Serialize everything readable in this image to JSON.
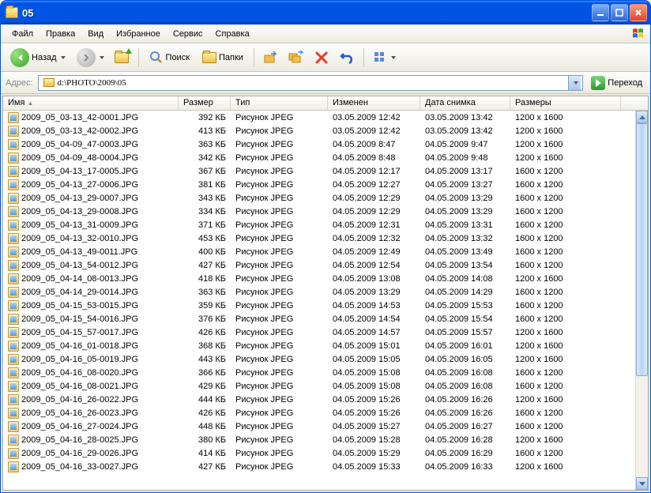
{
  "window": {
    "title": "05"
  },
  "menu": {
    "file": "Файл",
    "edit": "Правка",
    "view": "Вид",
    "favorites": "Избранное",
    "tools": "Сервис",
    "help": "Справка"
  },
  "toolbar": {
    "back": "Назад",
    "search": "Поиск",
    "folders": "Папки"
  },
  "addressbar": {
    "label": "Адрес:",
    "path": "d:\\PHOTO\\2009\\05",
    "go": "Переход"
  },
  "columns": {
    "name": "Имя",
    "size": "Размер",
    "type": "Тип",
    "modified": "Изменен",
    "shot": "Дата снимка",
    "dim": "Размеры"
  },
  "file_type": "Рисунок JPEG",
  "files": [
    {
      "name": "2009_05_03-13_42-0001.JPG",
      "size": "392 КБ",
      "mod": "03.05.2009 12:42",
      "shot": "03.05.2009 13:42",
      "dim": "1200 x 1600"
    },
    {
      "name": "2009_05_03-13_42-0002.JPG",
      "size": "413 КБ",
      "mod": "03.05.2009 12:42",
      "shot": "03.05.2009 13:42",
      "dim": "1200 x 1600"
    },
    {
      "name": "2009_05_04-09_47-0003.JPG",
      "size": "363 КБ",
      "mod": "04.05.2009 8:47",
      "shot": "04.05.2009 9:47",
      "dim": "1200 x 1600"
    },
    {
      "name": "2009_05_04-09_48-0004.JPG",
      "size": "342 КБ",
      "mod": "04.05.2009 8:48",
      "shot": "04.05.2009 9:48",
      "dim": "1200 x 1600"
    },
    {
      "name": "2009_05_04-13_17-0005.JPG",
      "size": "367 КБ",
      "mod": "04.05.2009 12:17",
      "shot": "04.05.2009 13:17",
      "dim": "1600 x 1200"
    },
    {
      "name": "2009_05_04-13_27-0006.JPG",
      "size": "381 КБ",
      "mod": "04.05.2009 12:27",
      "shot": "04.05.2009 13:27",
      "dim": "1600 x 1200"
    },
    {
      "name": "2009_05_04-13_29-0007.JPG",
      "size": "343 КБ",
      "mod": "04.05.2009 12:29",
      "shot": "04.05.2009 13:29",
      "dim": "1600 x 1200"
    },
    {
      "name": "2009_05_04-13_29-0008.JPG",
      "size": "334 КБ",
      "mod": "04.05.2009 12:29",
      "shot": "04.05.2009 13:29",
      "dim": "1600 x 1200"
    },
    {
      "name": "2009_05_04-13_31-0009.JPG",
      "size": "371 КБ",
      "mod": "04.05.2009 12:31",
      "shot": "04.05.2009 13:31",
      "dim": "1600 x 1200"
    },
    {
      "name": "2009_05_04-13_32-0010.JPG",
      "size": "453 КБ",
      "mod": "04.05.2009 12:32",
      "shot": "04.05.2009 13:32",
      "dim": "1600 x 1200"
    },
    {
      "name": "2009_05_04-13_49-0011.JPG",
      "size": "400 КБ",
      "mod": "04.05.2009 12:49",
      "shot": "04.05.2009 13:49",
      "dim": "1600 x 1200"
    },
    {
      "name": "2009_05_04-13_54-0012.JPG",
      "size": "427 КБ",
      "mod": "04.05.2009 12:54",
      "shot": "04.05.2009 13:54",
      "dim": "1600 x 1200"
    },
    {
      "name": "2009_05_04-14_08-0013.JPG",
      "size": "418 КБ",
      "mod": "04.05.2009 13:08",
      "shot": "04.05.2009 14:08",
      "dim": "1200 x 1600"
    },
    {
      "name": "2009_05_04-14_29-0014.JPG",
      "size": "363 КБ",
      "mod": "04.05.2009 13:29",
      "shot": "04.05.2009 14:29",
      "dim": "1600 x 1200"
    },
    {
      "name": "2009_05_04-15_53-0015.JPG",
      "size": "359 КБ",
      "mod": "04.05.2009 14:53",
      "shot": "04.05.2009 15:53",
      "dim": "1600 x 1200"
    },
    {
      "name": "2009_05_04-15_54-0016.JPG",
      "size": "376 КБ",
      "mod": "04.05.2009 14:54",
      "shot": "04.05.2009 15:54",
      "dim": "1600 x 1200"
    },
    {
      "name": "2009_05_04-15_57-0017.JPG",
      "size": "426 КБ",
      "mod": "04.05.2009 14:57",
      "shot": "04.05.2009 15:57",
      "dim": "1200 x 1600"
    },
    {
      "name": "2009_05_04-16_01-0018.JPG",
      "size": "368 КБ",
      "mod": "04.05.2009 15:01",
      "shot": "04.05.2009 16:01",
      "dim": "1200 x 1600"
    },
    {
      "name": "2009_05_04-16_05-0019.JPG",
      "size": "443 КБ",
      "mod": "04.05.2009 15:05",
      "shot": "04.05.2009 16:05",
      "dim": "1200 x 1600"
    },
    {
      "name": "2009_05_04-16_08-0020.JPG",
      "size": "366 КБ",
      "mod": "04.05.2009 15:08",
      "shot": "04.05.2009 16:08",
      "dim": "1600 x 1200"
    },
    {
      "name": "2009_05_04-16_08-0021.JPG",
      "size": "429 КБ",
      "mod": "04.05.2009 15:08",
      "shot": "04.05.2009 16:08",
      "dim": "1600 x 1200"
    },
    {
      "name": "2009_05_04-16_26-0022.JPG",
      "size": "444 КБ",
      "mod": "04.05.2009 15:26",
      "shot": "04.05.2009 16:26",
      "dim": "1200 x 1600"
    },
    {
      "name": "2009_05_04-16_26-0023.JPG",
      "size": "426 КБ",
      "mod": "04.05.2009 15:26",
      "shot": "04.05.2009 16:26",
      "dim": "1600 x 1200"
    },
    {
      "name": "2009_05_04-16_27-0024.JPG",
      "size": "448 КБ",
      "mod": "04.05.2009 15:27",
      "shot": "04.05.2009 16:27",
      "dim": "1600 x 1200"
    },
    {
      "name": "2009_05_04-16_28-0025.JPG",
      "size": "380 КБ",
      "mod": "04.05.2009 15:28",
      "shot": "04.05.2009 16:28",
      "dim": "1200 x 1600"
    },
    {
      "name": "2009_05_04-16_29-0026.JPG",
      "size": "414 КБ",
      "mod": "04.05.2009 15:29",
      "shot": "04.05.2009 16:29",
      "dim": "1600 x 1200"
    },
    {
      "name": "2009_05_04-16_33-0027.JPG",
      "size": "427 КБ",
      "mod": "04.05.2009 15:33",
      "shot": "04.05.2009 16:33",
      "dim": "1200 x 1600"
    }
  ]
}
